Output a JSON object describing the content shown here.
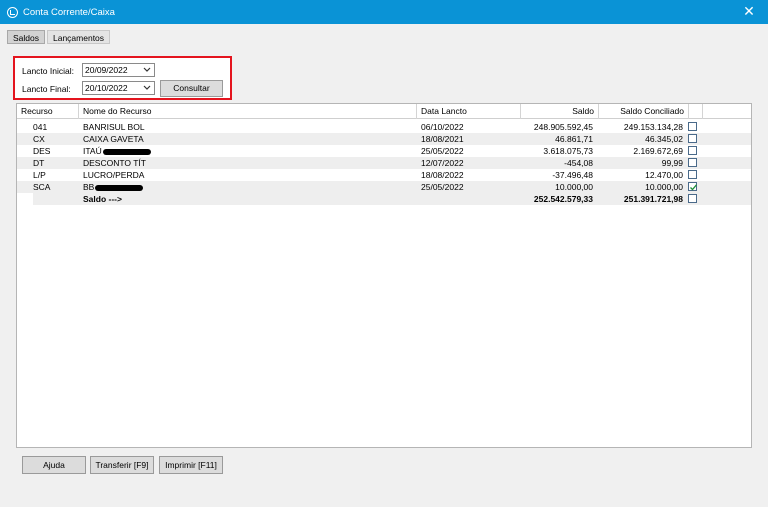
{
  "window": {
    "title": "Conta Corrente/Caixa"
  },
  "tabs": [
    {
      "label": "Saldos",
      "active": true
    },
    {
      "label": "Lançamentos",
      "active": false
    }
  ],
  "filter": {
    "initial_label": "Lancto Inicial:",
    "initial_value": "20/09/2022",
    "final_label": "Lancto Final:",
    "final_value": "20/10/2022",
    "consult_button": "Consultar"
  },
  "table": {
    "headers": [
      "Recurso",
      "Nome do Recurso",
      "Data Lancto",
      "Saldo",
      "Saldo Conciliado"
    ],
    "rows": [
      {
        "recurso": "041",
        "nome": "BANRISUL BOL",
        "redacted": false,
        "data": "06/10/2022",
        "saldo": "248.905.592,45",
        "conciliado": "249.153.134,28",
        "checked": false
      },
      {
        "recurso": "CX",
        "nome": "CAIXA GAVETA",
        "redacted": false,
        "data": "18/08/2021",
        "saldo": "46.861,71",
        "conciliado": "46.345,02",
        "checked": false
      },
      {
        "recurso": "DES",
        "nome": "ITAÚ",
        "redacted": true,
        "data": "25/05/2022",
        "saldo": "3.618.075,73",
        "conciliado": "2.169.672,69",
        "checked": false
      },
      {
        "recurso": "DT",
        "nome": "DESCONTO TÍT",
        "redacted": false,
        "data": "12/07/2022",
        "saldo": "-454,08",
        "conciliado": "99,99",
        "checked": false
      },
      {
        "recurso": "L/P",
        "nome": "LUCRO/PERDA",
        "redacted": false,
        "data": "18/08/2022",
        "saldo": "-37.496,48",
        "conciliado": "12.470,00",
        "checked": false
      },
      {
        "recurso": "SCA",
        "nome": "BB",
        "redacted": true,
        "data": "25/05/2022",
        "saldo": "10.000,00",
        "conciliado": "10.000,00",
        "checked": true
      }
    ],
    "total": {
      "label": "Saldo --->",
      "saldo": "252.542.579,33",
      "conciliado": "251.391.721,98",
      "checked": false
    }
  },
  "buttons": {
    "help": "Ajuda",
    "transfer": "Transferir [F9]",
    "print": "Imprimir [F11]"
  },
  "colors": {
    "titlebar": "#0a93d6",
    "highlight_border": "#e4141e",
    "check": "#1f8f3a"
  }
}
